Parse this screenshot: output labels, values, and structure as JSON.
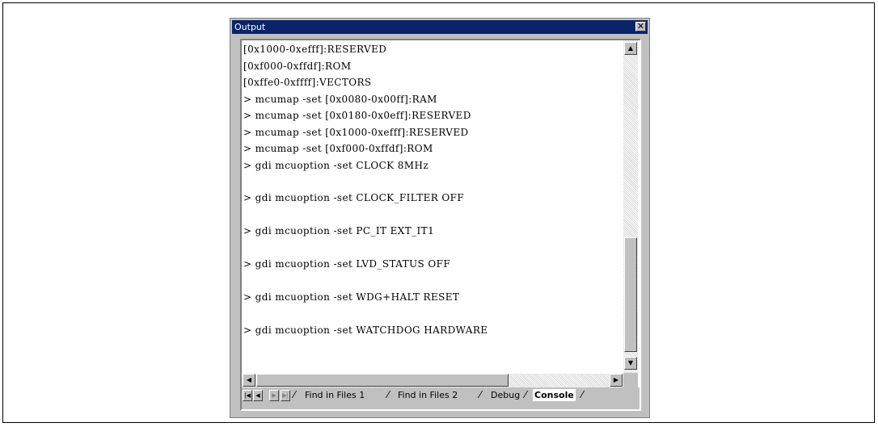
{
  "window": {
    "title": "Output",
    "close_glyph": "✕"
  },
  "console": {
    "lines": [
      "[0x1000-0xefff]:RESERVED",
      "[0xf000-0xffdf]:ROM",
      "[0xffe0-0xffff]:VECTORS",
      "> mcumap -set [0x0080-0x00ff]:RAM",
      "> mcumap -set [0x0180-0x0eff]:RESERVED",
      "> mcumap -set [0x1000-0xefff]:RESERVED",
      "> mcumap -set [0xf000-0xffdf]:ROM",
      "> gdi mcuoption -set CLOCK 8MHz",
      "> gdi mcuoption -set CLOCK_FILTER OFF",
      "> gdi mcuoption -set PC_IT EXT_IT1",
      "> gdi mcuoption -set LVD_STATUS OFF",
      "> gdi mcuoption -set WDG+HALT RESET",
      "> gdi mcuoption -set WATCHDOG HARDWARE"
    ]
  },
  "tabs": [
    {
      "label": "Find in Files 1",
      "active": false
    },
    {
      "label": "Find in Files 2",
      "active": false
    },
    {
      "label": "Debug",
      "active": false
    },
    {
      "label": "Console",
      "active": true
    }
  ],
  "icons": {
    "scroll_up": "▲",
    "scroll_down": "▼",
    "scroll_left": "◀",
    "scroll_right": "▶",
    "nav_first": "|◀",
    "nav_prev": "◀",
    "nav_next": "▶",
    "nav_last": "▶|"
  },
  "scroll": {
    "vertical_position": 0.85,
    "horizontal_position": 0.0
  }
}
